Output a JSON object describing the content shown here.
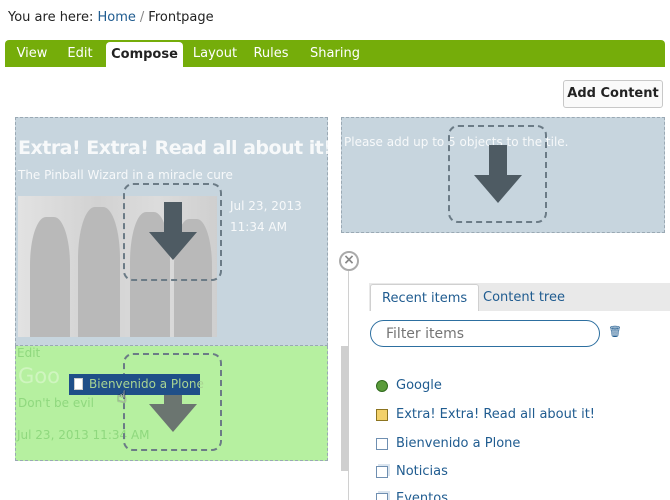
{
  "breadcrumb": {
    "prefix": "You are here:",
    "home": "Home",
    "separator": "/",
    "current": "Frontpage"
  },
  "tabs": [
    {
      "label": "View"
    },
    {
      "label": "Edit"
    },
    {
      "label": "Compose",
      "active": true
    },
    {
      "label": "Layout"
    },
    {
      "label": "Rules"
    },
    {
      "label": "Sharing"
    }
  ],
  "colors": {
    "tab_bar": "#75ad0a",
    "tile_blue": "#c7d5de",
    "tile_green": "#b6f0a0",
    "link": "#205c90"
  },
  "toolbar": {
    "add_content": "Add Content"
  },
  "news_tile": {
    "title": "Extra! Extra! Read all about it!",
    "description": "The Pinball Wizard in a miracle cure",
    "date": "Jul 23, 2013",
    "time": "11:34 AM"
  },
  "google_tile": {
    "edit_link": "Edit",
    "title": "Goo",
    "description": "Don't be evil",
    "datetime": "Jul 23, 2013 11:34 AM"
  },
  "drag_item": {
    "label": "Bienvenido a Plone",
    "icon": "document-icon"
  },
  "right_tile": {
    "placeholder": "Please add up to 5 objects to the tile."
  },
  "panel": {
    "tabs": [
      {
        "label": "Recent items",
        "active": true
      },
      {
        "label": "Content tree"
      }
    ],
    "filter_placeholder": "Filter items",
    "items": [
      {
        "label": "Google",
        "icon": "link-globe-icon"
      },
      {
        "label": "Extra! Extra! Read all about it!",
        "icon": "news-item-icon"
      },
      {
        "label": "Bienvenido a Plone",
        "icon": "document-icon"
      },
      {
        "label": "Noticias",
        "icon": "collection-icon"
      },
      {
        "label": "Eventos",
        "icon": "collection-icon"
      }
    ]
  }
}
